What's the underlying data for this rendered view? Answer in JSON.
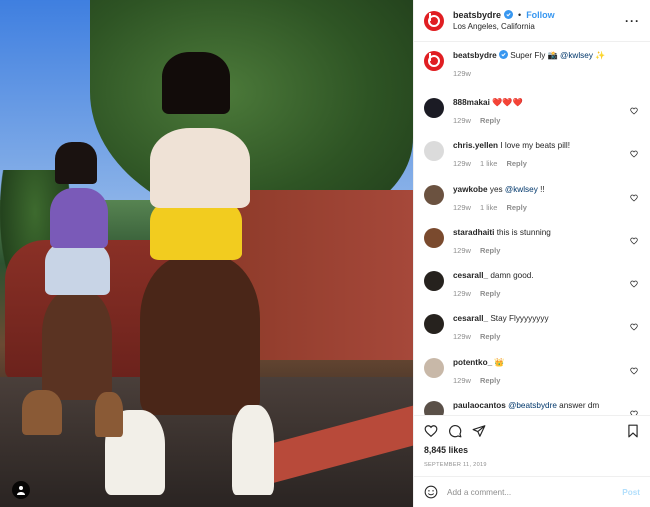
{
  "header": {
    "username": "beatsbydre",
    "follow_label": "Follow",
    "location": "Los Angeles, California"
  },
  "caption": {
    "username": "beatsbydre",
    "text": "Super Fly 📸 ",
    "mention": "@kwlsey",
    "suffix": " ✨",
    "time": "129w"
  },
  "comments": [
    {
      "username": "888makai",
      "text": "❤️❤️❤️",
      "time": "129w",
      "likes": "",
      "reply": "Reply",
      "avatar_color": "#1b1b24"
    },
    {
      "username": "chris.yellen",
      "text": "I love my beats pill!",
      "time": "129w",
      "likes": "1 like",
      "reply": "Reply",
      "avatar_color": "#dbdbdb"
    },
    {
      "username": "yawkobe",
      "text": "yes ",
      "mention": "@kwlsey",
      "suffix": " !!",
      "time": "129w",
      "likes": "1 like",
      "reply": "Reply",
      "avatar_color": "#6b5240"
    },
    {
      "username": "staradhaiti",
      "text": "this is stunning",
      "time": "129w",
      "likes": "",
      "reply": "Reply",
      "avatar_color": "#7a4a2e"
    },
    {
      "username": "cesarall_",
      "text": "damn good.",
      "time": "129w",
      "likes": "",
      "reply": "Reply",
      "avatar_color": "#26221e"
    },
    {
      "username": "cesarall_",
      "text": "Stay Flyyyyyyyy",
      "time": "129w",
      "likes": "",
      "reply": "Reply",
      "avatar_color": "#26221e"
    },
    {
      "username": "potentko_",
      "text": "👑",
      "time": "129w",
      "likes": "",
      "reply": "Reply",
      "avatar_color": "#c8b8a8"
    },
    {
      "username": "paulaocantos",
      "text": "",
      "mention": "@beatsbydre",
      "suffix": " answer dm",
      "time": "",
      "likes": "",
      "reply": "",
      "avatar_color": "#5a5048"
    }
  ],
  "likes": "8,845 likes",
  "date": "SEPTEMBER 11, 2019",
  "comment_box": {
    "placeholder": "Add a comment...",
    "post_label": "Post"
  },
  "colors": {
    "brand_red": "#e01e22",
    "link_blue": "#3897f0",
    "mention": "#00376b",
    "muted": "#8e8e8e"
  }
}
